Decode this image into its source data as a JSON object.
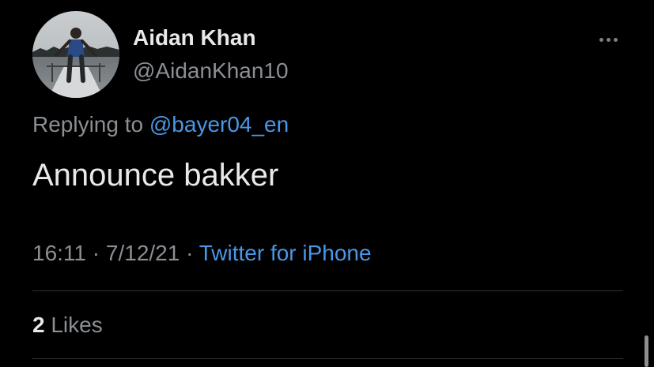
{
  "author": {
    "display_name": "Aidan Khan",
    "handle": "@AidanKhan10",
    "avatar": "avatar-photo-person-on-boat"
  },
  "reply": {
    "prefix": "Replying to",
    "mention": "@bayer04_en"
  },
  "tweet": {
    "text": "Announce bakker",
    "time": "16:11",
    "date": "7/12/21",
    "separator": "·",
    "source": "Twitter for iPhone"
  },
  "stats": {
    "likes_count": "2",
    "likes_label": "Likes"
  },
  "icons": {
    "more": "more-horizontal-icon"
  },
  "colors": {
    "background": "#000000",
    "primary_text": "#e7e9ea",
    "secondary_text": "#8b8f94",
    "link": "#4a97e6",
    "divider": "#2f3336"
  }
}
